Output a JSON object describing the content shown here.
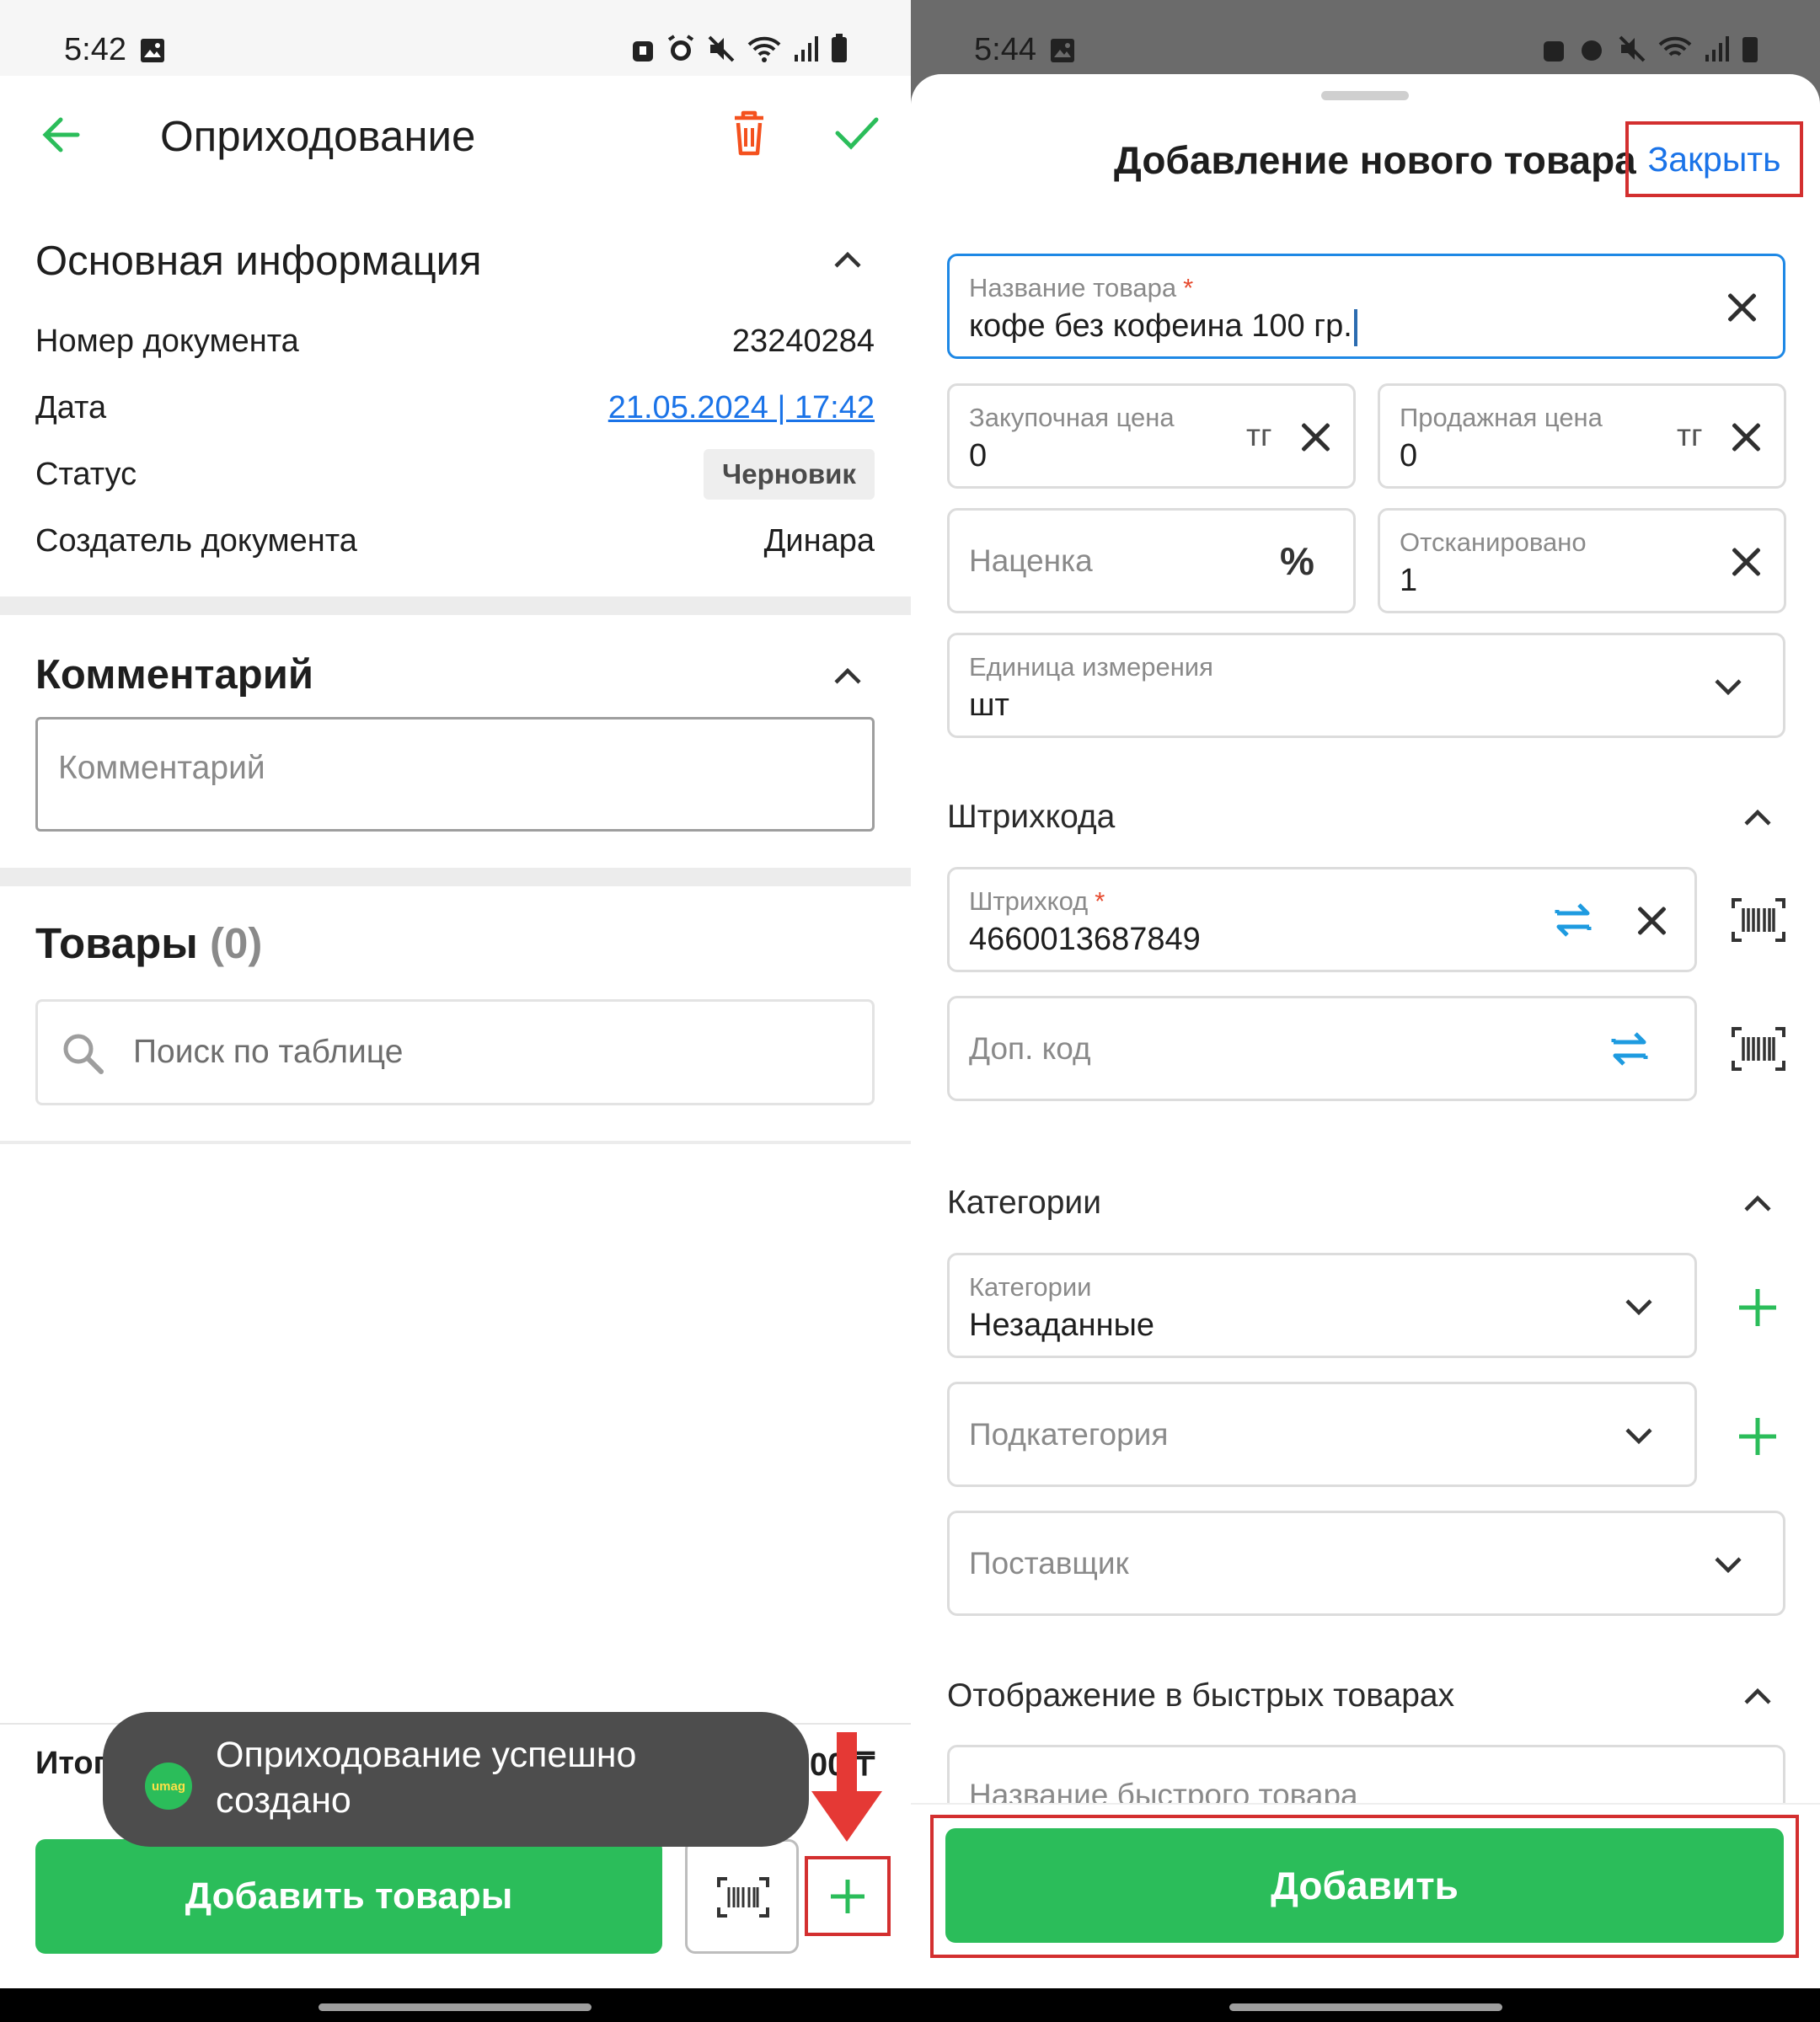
{
  "left_screen": {
    "status": {
      "time": "5:42"
    },
    "header": {
      "title": "Оприходование"
    },
    "main_info": {
      "title": "Основная информация",
      "rows": [
        {
          "label": "Номер документа",
          "value": "23240284"
        },
        {
          "label": "Дата",
          "value": "21.05.2024 | 17:42"
        },
        {
          "label": "Статус",
          "value": "Черновик"
        },
        {
          "label": "Создатель документа",
          "value": "Динара"
        }
      ]
    },
    "comment": {
      "title": "Комментарий",
      "placeholder": "Комментарий"
    },
    "goods": {
      "title": "Товары",
      "count": "(0)",
      "search_placeholder": "Поиск по таблице"
    },
    "footer": {
      "total_label": "Итого",
      "total_value": "0.00 ₸",
      "add_goods_label": "Добавить товары"
    },
    "toast": {
      "logo_text": "umag",
      "text_line1": "Оприходование успешно",
      "text_line2": "создано"
    }
  },
  "right_screen": {
    "status": {
      "time": "5:44"
    },
    "sheet_title": "Добавление нового товара",
    "close_label": "Закрыть",
    "fields": {
      "name": {
        "label": "Название товара",
        "required": "*",
        "value": "кофе без кофеина 100 гр."
      },
      "purchase_price": {
        "label": "Закупочная цена",
        "value": "0",
        "unit": "тг"
      },
      "sale_price": {
        "label": "Продажная цена",
        "value": "0",
        "unit": "тг"
      },
      "markup": {
        "placeholder": "Наценка",
        "unit": "%"
      },
      "scanned": {
        "label": "Отсканировано",
        "value": "1"
      },
      "unit": {
        "label": "Единица измерения",
        "value": "шт"
      }
    },
    "barcodes": {
      "title": "Штрихкода",
      "barcode": {
        "label": "Штрихкод",
        "required": "*",
        "value": "4660013687849"
      },
      "extra_code": {
        "placeholder": "Доп. код"
      }
    },
    "categories": {
      "title": "Категории",
      "category": {
        "label": "Категории",
        "value": "Незаданные"
      },
      "subcategory": {
        "placeholder": "Подкатегория"
      },
      "supplier": {
        "placeholder": "Поставщик"
      }
    },
    "quick": {
      "title": "Отображение в быстрых товарах",
      "name_placeholder": "Название быстрого товара"
    },
    "add_label": "Добавить"
  },
  "colors": {
    "green": "#2bbd5a",
    "blue": "#1a73e8",
    "red": "#e5383b",
    "highlight": "#d32f2f"
  }
}
